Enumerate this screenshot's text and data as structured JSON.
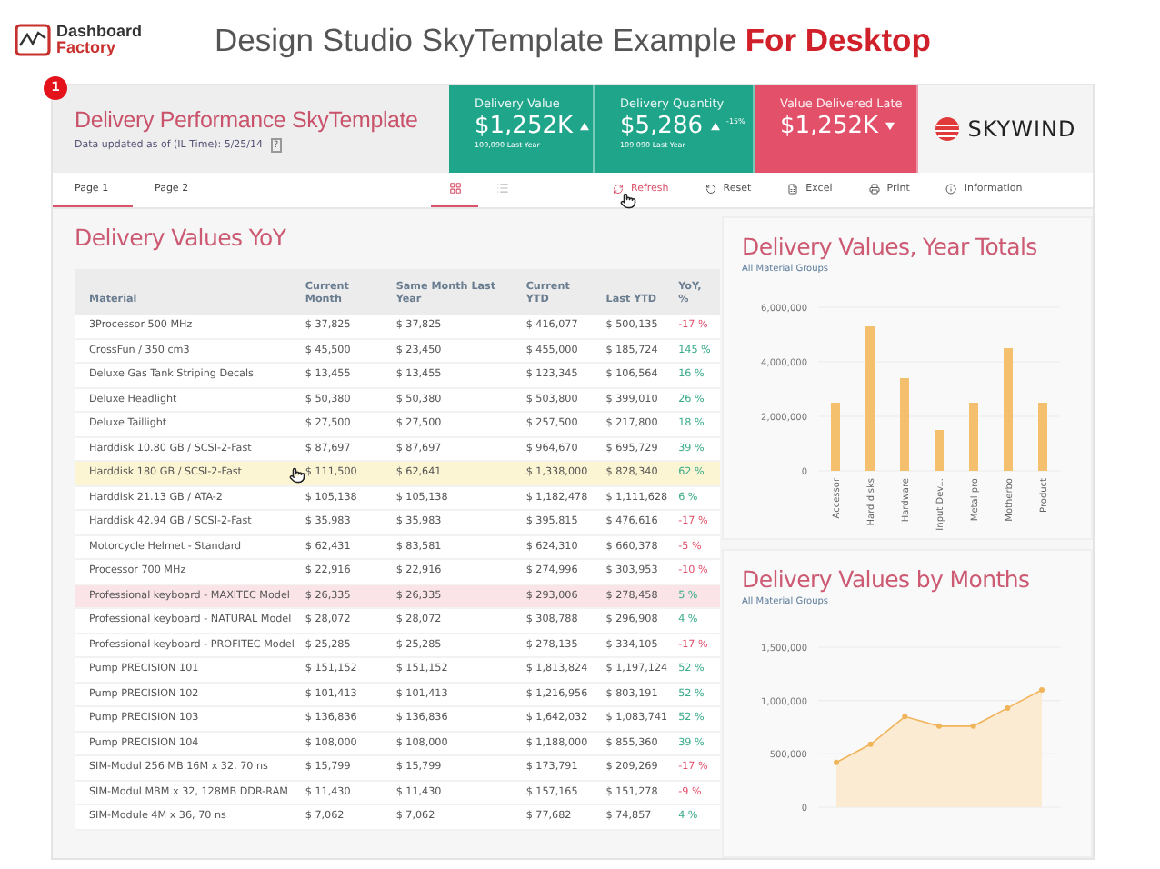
{
  "brand": {
    "line1": "Dashboard",
    "line2": "Factory"
  },
  "heading": {
    "title": "Design Studio SkyTemplate Example",
    "highlight": "For Desktop"
  },
  "dashboard": {
    "badge": "1",
    "title": "Delivery Performance SkyTemplate",
    "updated": "Data updated as of (IL Time): 5/25/14",
    "help": "?",
    "tiles": [
      {
        "label": "Delivery Value",
        "value": "$1,252K",
        "rising": true,
        "note": "109,090 Last Year",
        "color": "#1fa58a"
      },
      {
        "label": "Delivery Quantity",
        "value": "$5,286",
        "rising": true,
        "change": "-15%",
        "note": "109,090 Last Year",
        "color": "#1fa58a"
      },
      {
        "label": "Value Delivered Late",
        "value": "$1,252K",
        "rising": false,
        "color": "#e2506a"
      }
    ],
    "logo": "SKYWIND"
  },
  "tabs": [
    {
      "label": "Page 1",
      "selected": true
    },
    {
      "label": "Page 2",
      "selected": false
    }
  ],
  "views": [
    {
      "kind": "grid",
      "selected": true
    },
    {
      "kind": "list",
      "selected": false
    }
  ],
  "actions": [
    {
      "kind": "refresh",
      "label": "Refresh",
      "hovered": true
    },
    {
      "kind": "reset",
      "label": "Reset",
      "hovered": false
    },
    {
      "kind": "excel",
      "label": "Excel",
      "hovered": false
    },
    {
      "kind": "print",
      "label": "Print",
      "hovered": false
    },
    {
      "kind": "info",
      "label": "Information",
      "hovered": false
    }
  ],
  "table": {
    "title": "Delivery Values YoY",
    "columns": [
      "Material",
      "Current Month",
      "Same Month Last Year",
      "Current YTD",
      "Last YTD",
      "YoY, %"
    ],
    "rows": [
      {
        "cells": [
          "3Processor  500 MHz",
          "$ 37,825",
          "$ 37,825",
          "$ 416,077",
          "$ 500,135",
          "-17 %"
        ],
        "positive": false,
        "selected": false,
        "hovered": false
      },
      {
        "cells": [
          "CrossFun / 350 cm3",
          "$ 45,500",
          "$ 23,450",
          "$ 455,000",
          "$ 185,724",
          "145 %"
        ],
        "positive": true,
        "selected": false,
        "hovered": false
      },
      {
        "cells": [
          "Deluxe Gas Tank Striping Decals",
          "$ 13,455",
          "$ 13,455",
          "$ 123,345",
          "$ 106,564",
          "16 %"
        ],
        "positive": true,
        "selected": false,
        "hovered": false
      },
      {
        "cells": [
          "Deluxe Headlight",
          "$ 50,380",
          "$ 50,380",
          "$ 503,800",
          "$ 399,010",
          "26 %"
        ],
        "positive": true,
        "selected": false,
        "hovered": false
      },
      {
        "cells": [
          "Deluxe Taillight",
          "$ 27,500",
          "$ 27,500",
          "$ 257,500",
          "$ 217,800",
          "18 %"
        ],
        "positive": true,
        "selected": false,
        "hovered": false
      },
      {
        "cells": [
          "Harddisk 10.80 GB  / SCSI-2-Fast",
          "$ 87,697",
          "$ 87,697",
          "$ 964,670",
          "$ 695,729",
          "39 %"
        ],
        "positive": true,
        "selected": false,
        "hovered": false
      },
      {
        "cells": [
          "Harddisk 180 GB / SCSI-2-Fast",
          "$ 111,500",
          "$ 62,641",
          "$ 1,338,000",
          "$ 828,340",
          "62 %"
        ],
        "positive": true,
        "selected": false,
        "hovered": true
      },
      {
        "cells": [
          "Harddisk 21.13 GB / ATA-2",
          "$ 105,138",
          "$ 105,138",
          "$ 1,182,478",
          "$ 1,111,628",
          "6 %"
        ],
        "positive": true,
        "selected": false,
        "hovered": false
      },
      {
        "cells": [
          "Harddisk 42.94 GB / SCSI-2-Fast",
          "$ 35,983",
          "$ 35,983",
          "$ 395,815",
          "$ 476,616",
          "-17 %"
        ],
        "positive": false,
        "selected": false,
        "hovered": false
      },
      {
        "cells": [
          "Motorcycle Helmet - Standard",
          "$ 62,431",
          "$ 83,581",
          "$ 624,310",
          "$ 660,378",
          "-5 %"
        ],
        "positive": false,
        "selected": false,
        "hovered": false
      },
      {
        "cells": [
          "Processor  700  MHz",
          "$ 22,916",
          "$ 22,916",
          "$ 274,996",
          "$ 303,953",
          "-10 %"
        ],
        "positive": false,
        "selected": false,
        "hovered": false
      },
      {
        "cells": [
          "Professional keyboard - MAXITEC Model",
          "$ 26,335",
          "$ 26,335",
          "$ 293,006",
          "$ 278,458",
          "5 %"
        ],
        "positive": true,
        "selected": true,
        "hovered": false
      },
      {
        "cells": [
          "Professional keyboard - NATURAL Model",
          "$ 28,072",
          "$ 28,072",
          "$ 308,788",
          "$ 296,908",
          "4 %"
        ],
        "positive": true,
        "selected": false,
        "hovered": false
      },
      {
        "cells": [
          "Professional keyboard - PROFITEC Model",
          "$ 25,285",
          "$ 25,285",
          "$ 278,135",
          "$ 334,105",
          "-17 %"
        ],
        "positive": false,
        "selected": false,
        "hovered": false
      },
      {
        "cells": [
          "Pump PRECISION 101",
          "$ 151,152",
          "$ 151,152",
          "$ 1,813,824",
          "$ 1,197,124",
          "52 %"
        ],
        "positive": true,
        "selected": false,
        "hovered": false
      },
      {
        "cells": [
          "Pump PRECISION 102",
          "$ 101,413",
          "$ 101,413",
          "$ 1,216,956",
          "$ 803,191",
          "52 %"
        ],
        "positive": true,
        "selected": false,
        "hovered": false
      },
      {
        "cells": [
          "Pump PRECISION 103",
          "$ 136,836",
          "$ 136,836",
          "$ 1,642,032",
          "$ 1,083,741",
          "52 %"
        ],
        "positive": true,
        "selected": false,
        "hovered": false
      },
      {
        "cells": [
          "Pump PRECISION 104",
          "$ 108,000",
          "$ 108,000",
          "$ 1,188,000",
          "$ 855,360",
          "39 %"
        ],
        "positive": true,
        "selected": false,
        "hovered": false
      },
      {
        "cells": [
          "SIM-Modul 256 MB 16M x 32, 70 ns",
          "$ 15,799",
          "$ 15,799",
          "$ 173,791",
          "$ 209,269",
          "-17 %"
        ],
        "positive": false,
        "selected": false,
        "hovered": false
      },
      {
        "cells": [
          "SIM-Modul MBM x 32, 128MB  DDR-RAM",
          "$ 11,430",
          "$ 11,430",
          "$ 157,165",
          "$ 151,278",
          "-9 %"
        ],
        "positive": false,
        "selected": false,
        "hovered": false
      },
      {
        "cells": [
          "SIM-Module 4M x 36, 70 ns",
          "$ 7,062",
          "$ 7,062",
          "$ 77,682",
          "$ 74,857",
          "4 %"
        ],
        "positive": true,
        "selected": false,
        "hovered": false
      }
    ]
  },
  "year_totals": {
    "title": "Delivery Values, Year Totals",
    "subtitle": "All Material Groups",
    "chart_data": {
      "type": "bar",
      "categories": [
        "Accessor",
        "Hard disks",
        "Hardware",
        "Input Dev...",
        "Metal pro",
        "Motherbo",
        "Product"
      ],
      "series": [
        {
          "color": "#f5c06e",
          "values": [
            2500000,
            5300000,
            3400000,
            1500000,
            2500000,
            4500000,
            2500000
          ]
        }
      ],
      "ylim": [
        0,
        6000000
      ],
      "yticks": [
        {
          "value": 0,
          "label": "0"
        },
        {
          "value": 2000000,
          "label": "2,000,000"
        },
        {
          "value": 4000000,
          "label": "4,000,000"
        },
        {
          "value": 6000000,
          "label": "6,000,000"
        }
      ]
    }
  },
  "by_months": {
    "title": "Delivery Values by Months",
    "subtitle": "All Material Groups",
    "chart_data": {
      "type": "area",
      "series": [
        {
          "color": "#f0b45a",
          "values": [
            420000,
            590000,
            850000,
            760000,
            760000,
            930000,
            1100000
          ]
        }
      ],
      "ylim": [
        0,
        1500000
      ],
      "yticks": [
        {
          "value": 0,
          "label": "0"
        },
        {
          "value": 500000,
          "label": "500,000"
        },
        {
          "value": 1000000,
          "label": "1,000,000"
        },
        {
          "value": 1500000,
          "label": "1,500,000"
        }
      ]
    }
  }
}
